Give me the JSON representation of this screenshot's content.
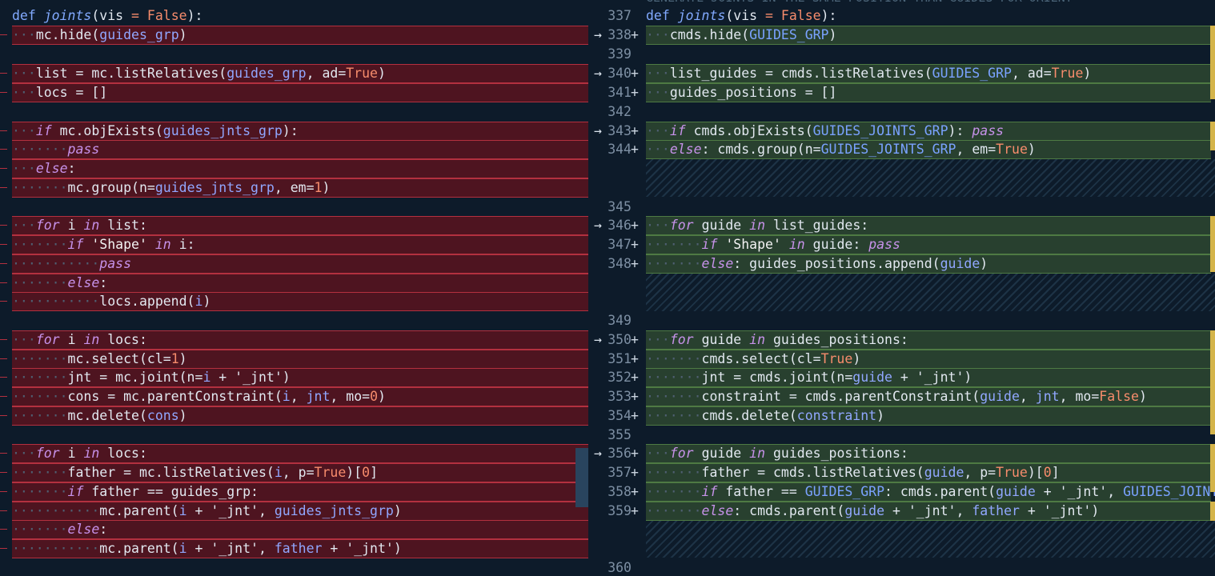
{
  "left": {
    "lines": [
      [
        [
          "kw-plain",
          "def "
        ],
        [
          "fn",
          "joints"
        ],
        [
          "var",
          "(vis "
        ],
        [
          "num",
          "= False"
        ],
        [
          "var",
          "):"
        ]
      ],
      [
        [
          "ws",
          "···"
        ],
        [
          "var",
          "mc.hide("
        ],
        [
          "id",
          "guides_grp"
        ],
        [
          "var",
          ")"
        ]
      ],
      [],
      [
        [
          "ws",
          "···"
        ],
        [
          "var",
          "list = mc.listRelatives("
        ],
        [
          "id",
          "guides_grp"
        ],
        [
          "var",
          ", ad="
        ],
        [
          "num",
          "True"
        ],
        [
          "var",
          ")"
        ]
      ],
      [
        [
          "ws",
          "···"
        ],
        [
          "var",
          "locs = []"
        ]
      ],
      [],
      [
        [
          "ws",
          "···"
        ],
        [
          "kw",
          "if "
        ],
        [
          "var",
          "mc.objExists("
        ],
        [
          "id",
          "guides_jnts_grp"
        ],
        [
          "var",
          "):"
        ]
      ],
      [
        [
          "ws",
          "·······"
        ],
        [
          "kw",
          "pass"
        ]
      ],
      [
        [
          "ws",
          "···"
        ],
        [
          "kw",
          "else"
        ],
        [
          "var",
          ":"
        ]
      ],
      [
        [
          "ws",
          "·······"
        ],
        [
          "var",
          "mc.group(n="
        ],
        [
          "id",
          "guides_jnts_grp"
        ],
        [
          "var",
          ", em="
        ],
        [
          "num",
          "1"
        ],
        [
          "var",
          ")"
        ]
      ],
      [],
      [
        [
          "ws",
          "···"
        ],
        [
          "kw",
          "for "
        ],
        [
          "var",
          "i "
        ],
        [
          "kw",
          "in "
        ],
        [
          "var",
          "list:"
        ]
      ],
      [
        [
          "ws",
          "·······"
        ],
        [
          "kw",
          "if "
        ],
        [
          "str",
          "'Shape' "
        ],
        [
          "kw",
          "in "
        ],
        [
          "var",
          "i:"
        ]
      ],
      [
        [
          "ws",
          "···········"
        ],
        [
          "kw",
          "pass"
        ]
      ],
      [
        [
          "ws",
          "·······"
        ],
        [
          "kw",
          "else"
        ],
        [
          "var",
          ":"
        ]
      ],
      [
        [
          "ws",
          "···········"
        ],
        [
          "var",
          "locs.append("
        ],
        [
          "id",
          "i"
        ],
        [
          "var",
          ")"
        ]
      ],
      [],
      [
        [
          "ws",
          "···"
        ],
        [
          "kw",
          "for "
        ],
        [
          "var",
          "i "
        ],
        [
          "kw",
          "in "
        ],
        [
          "var",
          "locs:"
        ]
      ],
      [
        [
          "ws",
          "·······"
        ],
        [
          "var",
          "mc.select(cl="
        ],
        [
          "num",
          "1"
        ],
        [
          "var",
          ")"
        ]
      ],
      [
        [
          "ws",
          "·······"
        ],
        [
          "var",
          "jnt = mc.joint(n="
        ],
        [
          "id",
          "i"
        ],
        [
          "var",
          " + '_jnt')"
        ]
      ],
      [
        [
          "ws",
          "·······"
        ],
        [
          "var",
          "cons = mc.parentConstraint("
        ],
        [
          "id",
          "i"
        ],
        [
          "var",
          ", "
        ],
        [
          "id",
          "jnt"
        ],
        [
          "var",
          ", mo="
        ],
        [
          "num",
          "0"
        ],
        [
          "var",
          ")"
        ]
      ],
      [
        [
          "ws",
          "·······"
        ],
        [
          "var",
          "mc.delete("
        ],
        [
          "id",
          "cons"
        ],
        [
          "var",
          ")"
        ]
      ],
      [],
      [
        [
          "ws",
          "···"
        ],
        [
          "kw",
          "for "
        ],
        [
          "var",
          "i "
        ],
        [
          "kw",
          "in "
        ],
        [
          "var",
          "locs:"
        ]
      ],
      [
        [
          "ws",
          "·······"
        ],
        [
          "var",
          "father = mc.listRelatives("
        ],
        [
          "id",
          "i"
        ],
        [
          "var",
          ", p="
        ],
        [
          "num",
          "True"
        ],
        [
          "var",
          ")["
        ],
        [
          "num",
          "0"
        ],
        [
          "var",
          "]"
        ]
      ],
      [
        [
          "ws",
          "·······"
        ],
        [
          "kw",
          "if "
        ],
        [
          "var",
          "father == guides_grp:"
        ]
      ],
      [
        [
          "ws",
          "···········"
        ],
        [
          "var",
          "mc.parent("
        ],
        [
          "id",
          "i"
        ],
        [
          "var",
          " + '_jnt', "
        ],
        [
          "id",
          "guides_jnts_grp"
        ],
        [
          "var",
          ")"
        ]
      ],
      [
        [
          "ws",
          "·······"
        ],
        [
          "kw",
          "else"
        ],
        [
          "var",
          ":"
        ]
      ],
      [
        [
          "ws",
          "···········"
        ],
        [
          "var",
          "mc.parent("
        ],
        [
          "id",
          "i"
        ],
        [
          "var",
          " + '_jnt', "
        ],
        [
          "id",
          "father"
        ],
        [
          "var",
          " + '_jnt')"
        ]
      ],
      []
    ]
  },
  "right": {
    "lines": [
      {
        "num": "337",
        "plus": false,
        "arrow": false,
        "ins": false,
        "code": [
          [
            "kw-plain",
            "def "
          ],
          [
            "fn",
            "joints"
          ],
          [
            "var",
            "(vis "
          ],
          [
            "num",
            "= False"
          ],
          [
            "var",
            "):"
          ]
        ]
      },
      {
        "num": "338",
        "plus": true,
        "arrow": true,
        "ins": true,
        "code": [
          [
            "ws",
            "···"
          ],
          [
            "var",
            "cmds.hide("
          ],
          [
            "cst",
            "GUIDES_GRP"
          ],
          [
            "var",
            ")"
          ]
        ]
      },
      {
        "num": "339",
        "plus": false,
        "arrow": false,
        "ins": false,
        "code": []
      },
      {
        "num": "340",
        "plus": true,
        "arrow": true,
        "ins": true,
        "code": [
          [
            "ws",
            "···"
          ],
          [
            "var",
            "list_guides = cmds.listRelatives("
          ],
          [
            "cst",
            "GUIDES_GRP"
          ],
          [
            "var",
            ", ad="
          ],
          [
            "num",
            "True"
          ],
          [
            "var",
            ")"
          ]
        ]
      },
      {
        "num": "341",
        "plus": true,
        "arrow": false,
        "ins": true,
        "code": [
          [
            "ws",
            "···"
          ],
          [
            "var",
            "guides_positions = []"
          ]
        ]
      },
      {
        "num": "342",
        "plus": false,
        "arrow": false,
        "ins": false,
        "code": []
      },
      {
        "num": "343",
        "plus": true,
        "arrow": true,
        "ins": true,
        "code": [
          [
            "ws",
            "···"
          ],
          [
            "kw",
            "if "
          ],
          [
            "var",
            "cmds.objExists("
          ],
          [
            "cst",
            "GUIDES_JOINTS_GRP"
          ],
          [
            "var",
            "): "
          ],
          [
            "kw",
            "pass"
          ]
        ]
      },
      {
        "num": "344",
        "plus": true,
        "arrow": false,
        "ins": true,
        "code": [
          [
            "ws",
            "···"
          ],
          [
            "kw",
            "else"
          ],
          [
            "var",
            ": cmds.group(n="
          ],
          [
            "cst",
            "GUIDES_JOINTS_GRP"
          ],
          [
            "var",
            ", em="
          ],
          [
            "num",
            "True"
          ],
          [
            "var",
            ")"
          ]
        ]
      },
      {
        "num": "345",
        "plus": false,
        "arrow": false,
        "ins": false,
        "code": []
      },
      {
        "num": "346",
        "plus": true,
        "arrow": true,
        "ins": true,
        "code": [
          [
            "ws",
            "···"
          ],
          [
            "kw",
            "for "
          ],
          [
            "var",
            "guide "
          ],
          [
            "kw",
            "in "
          ],
          [
            "var",
            "list_guides:"
          ]
        ]
      },
      {
        "num": "347",
        "plus": true,
        "arrow": false,
        "ins": true,
        "code": [
          [
            "ws",
            "·······"
          ],
          [
            "kw",
            "if "
          ],
          [
            "str",
            "'Shape' "
          ],
          [
            "kw",
            "in "
          ],
          [
            "var",
            "guide: "
          ],
          [
            "kw",
            "pass"
          ]
        ]
      },
      {
        "num": "348",
        "plus": true,
        "arrow": false,
        "ins": true,
        "code": [
          [
            "ws",
            "·······"
          ],
          [
            "kw",
            "else"
          ],
          [
            "var",
            ": guides_positions.append("
          ],
          [
            "id",
            "guide"
          ],
          [
            "var",
            ")"
          ]
        ]
      },
      {
        "num": "349",
        "plus": false,
        "arrow": false,
        "ins": false,
        "code": []
      },
      {
        "num": "350",
        "plus": true,
        "arrow": true,
        "ins": true,
        "code": [
          [
            "ws",
            "···"
          ],
          [
            "kw",
            "for "
          ],
          [
            "var",
            "guide "
          ],
          [
            "kw",
            "in "
          ],
          [
            "var",
            "guides_positions:"
          ]
        ]
      },
      {
        "num": "351",
        "plus": true,
        "arrow": false,
        "ins": true,
        "code": [
          [
            "ws",
            "·······"
          ],
          [
            "var",
            "cmds.select(cl="
          ],
          [
            "num",
            "True"
          ],
          [
            "var",
            ")"
          ]
        ]
      },
      {
        "num": "352",
        "plus": true,
        "arrow": false,
        "ins": true,
        "code": [
          [
            "ws",
            "·······"
          ],
          [
            "var",
            "jnt = cmds.joint(n="
          ],
          [
            "id",
            "guide"
          ],
          [
            "var",
            " + '_jnt')"
          ]
        ]
      },
      {
        "num": "353",
        "plus": true,
        "arrow": false,
        "ins": true,
        "code": [
          [
            "ws",
            "·······"
          ],
          [
            "var",
            "constraint = cmds.parentConstraint("
          ],
          [
            "id",
            "guide"
          ],
          [
            "var",
            ", "
          ],
          [
            "id",
            "jnt"
          ],
          [
            "var",
            ", mo="
          ],
          [
            "num",
            "False"
          ],
          [
            "var",
            ")"
          ]
        ]
      },
      {
        "num": "354",
        "plus": true,
        "arrow": false,
        "ins": true,
        "code": [
          [
            "ws",
            "·······"
          ],
          [
            "var",
            "cmds.delete("
          ],
          [
            "id",
            "constraint"
          ],
          [
            "var",
            ")"
          ]
        ]
      },
      {
        "num": "355",
        "plus": false,
        "arrow": false,
        "ins": false,
        "code": []
      },
      {
        "num": "356",
        "plus": true,
        "arrow": true,
        "ins": true,
        "code": [
          [
            "ws",
            "···"
          ],
          [
            "kw",
            "for "
          ],
          [
            "var",
            "guide "
          ],
          [
            "kw",
            "in "
          ],
          [
            "var",
            "guides_positions:"
          ]
        ]
      },
      {
        "num": "357",
        "plus": true,
        "arrow": false,
        "ins": true,
        "code": [
          [
            "ws",
            "·······"
          ],
          [
            "var",
            "father = cmds.listRelatives("
          ],
          [
            "id",
            "guide"
          ],
          [
            "var",
            ", p="
          ],
          [
            "num",
            "True"
          ],
          [
            "var",
            ")["
          ],
          [
            "num",
            "0"
          ],
          [
            "var",
            "]"
          ]
        ]
      },
      {
        "num": "358",
        "plus": true,
        "arrow": false,
        "ins": true,
        "code": [
          [
            "ws",
            "·······"
          ],
          [
            "kw",
            "if "
          ],
          [
            "var",
            "father == "
          ],
          [
            "cst",
            "GUIDES_GRP"
          ],
          [
            "var",
            ": cmds.parent("
          ],
          [
            "id",
            "guide"
          ],
          [
            "var",
            " + '_jnt', "
          ],
          [
            "cst",
            "GUIDES_JOINTS"
          ]
        ]
      },
      {
        "num": "359",
        "plus": true,
        "arrow": false,
        "ins": true,
        "code": [
          [
            "ws",
            "·······"
          ],
          [
            "kw",
            "else"
          ],
          [
            "var",
            ": cmds.parent("
          ],
          [
            "id",
            "guide"
          ],
          [
            "var",
            " + '_jnt', "
          ],
          [
            "id",
            "father"
          ],
          [
            "var",
            " + '_jnt')"
          ]
        ]
      },
      {
        "num": "360",
        "plus": false,
        "arrow": false,
        "ins": false,
        "code": []
      }
    ],
    "header_comment": "GENERATE JOINTS IN THE SAME POSITION THAN GUIDES FOR ORIENT"
  },
  "colors": {
    "editor_bg": "#0d1b2a",
    "deleted_bg": "#4e1420",
    "inserted_bg": "#28402f",
    "keyword": "#c792ea",
    "number": "#f78c6c",
    "function": "#82aaff"
  }
}
